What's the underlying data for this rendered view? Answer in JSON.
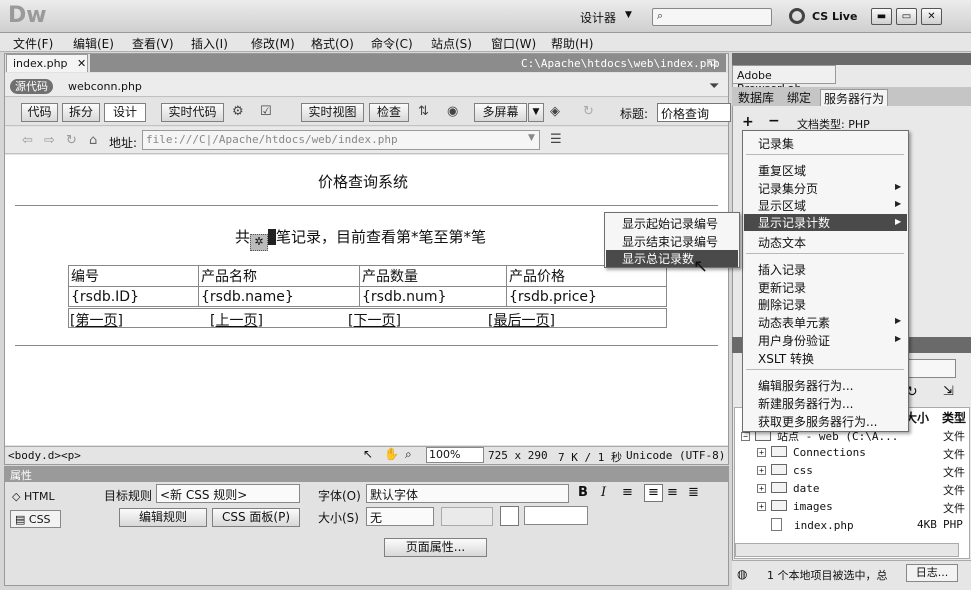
{
  "app": {
    "logo": "Dw",
    "workspace": "设计器",
    "cslive": "CS Live",
    "menu": [
      "文件(F)",
      "编辑(E)",
      "查看(V)",
      "插入(I)",
      "修改(M)",
      "格式(O)",
      "命令(C)",
      "站点(S)",
      "窗口(W)",
      "帮助(H)"
    ]
  },
  "doc": {
    "tab": "index.php",
    "path": "C:\\Apache\\htdocs\\web\\index.php",
    "source_badge": "源代码",
    "related_file": "webconn.php",
    "toolbar": {
      "code": "代码",
      "split": "拆分",
      "design": "设计",
      "live_code": "实时代码",
      "live_view": "实时视图",
      "inspect": "检查",
      "multiscreen": "多屏幕",
      "title_label": "标题:",
      "title_value": "价格查询"
    },
    "address": {
      "label": "地址:",
      "value": "file:///C|/Apache/htdocs/web/index.php"
    }
  },
  "page": {
    "heading": "价格查询系统",
    "record_prefix": "共",
    "record_rest": "笔记录，目前查看第*笔至第*笔",
    "table_headers": [
      "编号",
      "产品名称",
      "产品数量",
      "产品价格"
    ],
    "table_row": [
      "{rsdb.ID}",
      "{rsdb.name}",
      "{rsdb.num}",
      "{rsdb.price}"
    ],
    "nav_links": [
      "[第一页]",
      "[上一页]",
      "[下一页]",
      "[最后一页]"
    ]
  },
  "status": {
    "tags": "<body.d><p>",
    "zoom": "100%",
    "size": "725 x 290",
    "filesize": "7 K / 1 秒",
    "encoding": "Unicode (UTF-8)"
  },
  "props": {
    "title": "属性",
    "html": "HTML",
    "css": "CSS",
    "target_rule_label": "目标规则",
    "target_rule_value": "<新 CSS 规则>",
    "edit_rule": "编辑规则",
    "css_panel": "CSS 面板(P)",
    "font_label": "字体(O)",
    "font_value": "默认字体",
    "size_label": "大小(S)",
    "size_value": "无",
    "page_props": "页面属性..."
  },
  "right": {
    "browserlab": "Adobe BrowserLab",
    "tabs": [
      "数据库",
      "绑定",
      "服务器行为"
    ],
    "doctype_label": "文档类型: PHP",
    "menu": {
      "recordset": "记录集",
      "repeat": "重复区域",
      "paging": "记录集分页",
      "show_region": "显示区域",
      "show_count": "显示记录计数",
      "dynamic_text": "动态文本",
      "insert_record": "插入记录",
      "update_record": "更新记录",
      "delete_record": "删除记录",
      "dynamic_form": "动态表单元素",
      "user_auth": "用户身份验证",
      "xslt": "XSLT 转换",
      "edit_sb": "编辑服务器行为...",
      "new_sb": "新建服务器行为...",
      "more_sb": "获取更多服务器行为..."
    },
    "submenu": [
      "显示起始记录编号",
      "显示结束记录编号",
      "显示总记录数"
    ],
    "files": {
      "view": "视图",
      "size_col": "大小",
      "type_col": "类型",
      "site_row": "站点 - web (C:\\A...",
      "rows": [
        {
          "name": "Connections",
          "type": "文件"
        },
        {
          "name": "css",
          "type": "文件"
        },
        {
          "name": "date",
          "type": "文件"
        },
        {
          "name": "images",
          "type": "文件"
        },
        {
          "name": "index.php",
          "size": "4KB",
          "type": "PHP"
        }
      ],
      "status": "1 个本地项目被选中，总",
      "log": "日志..."
    }
  }
}
